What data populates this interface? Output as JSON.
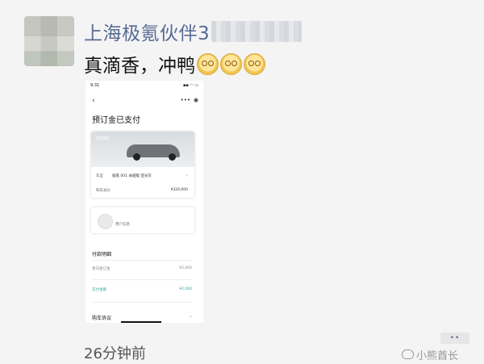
{
  "moment": {
    "poster_name": "上海极氪伙伴3",
    "text": "真滴香，冲鸭",
    "emoji_names": [
      "smirk-emoji",
      "smirk-emoji",
      "smirk-emoji"
    ],
    "time": "26分钟前",
    "more_label": "••"
  },
  "screenshot": {
    "status_time": "9:31",
    "status_icons": "▪▪ ◠ ▭",
    "back_glyph": "‹",
    "more_glyph": "•••",
    "target_glyph": "◉",
    "title": "预订金已支付",
    "car_tag": "ZEEKR",
    "car_name_label": "车型",
    "car_name_value": "极氪 001 卓越版 亚光灰",
    "price_label": "购车总价",
    "price_value": "¥320,000",
    "user_label": "用户信息",
    "section_title": "付款明细",
    "pay_rows": [
      {
        "label": "意向金订金",
        "amount": "¥2,000"
      },
      {
        "label": "实付金额",
        "amount": "¥2,000"
      }
    ],
    "agreement": "购车协议",
    "chevron": "›"
  },
  "watermark": {
    "text": "小熊酋长"
  },
  "colors": {
    "link": "#576b95",
    "accent_teal": "#3aa6a0"
  }
}
